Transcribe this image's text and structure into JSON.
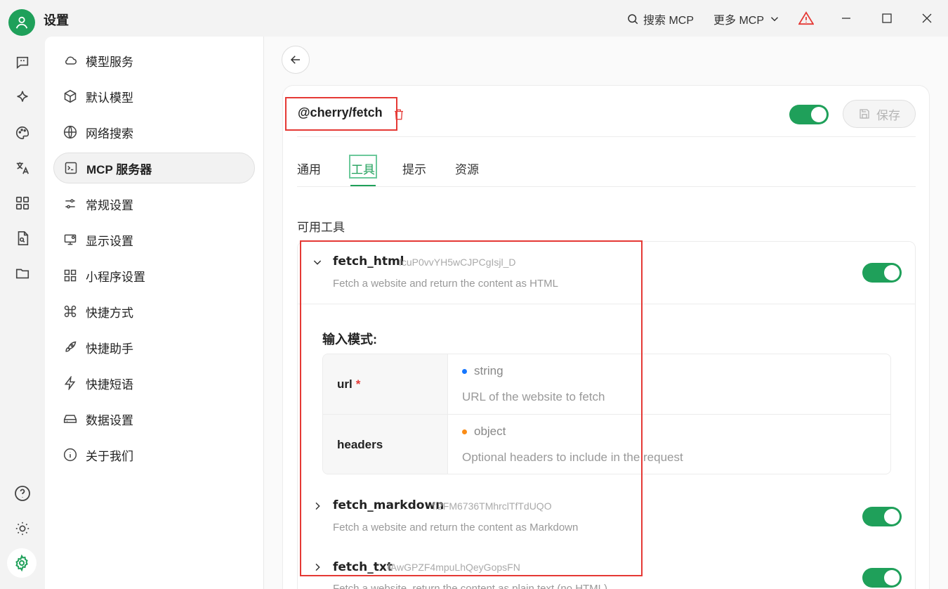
{
  "app": {
    "title": "设置"
  },
  "titlebar": {
    "search_label": "搜索 MCP",
    "more_label": "更多 MCP"
  },
  "colors": {
    "accent": "#1fa05a",
    "highlight_box": "#e53935",
    "warning": "#e53935"
  },
  "rail": {
    "icons": [
      "chat-icon",
      "sparkle-icon",
      "palette-icon",
      "translate-icon",
      "apps-grid-icon",
      "file-search-icon",
      "folder-icon",
      "help-icon",
      "sun-icon",
      "settings-gear-icon"
    ]
  },
  "menu": {
    "items": [
      {
        "label": "模型服务",
        "icon": "cloud-icon"
      },
      {
        "label": "默认模型",
        "icon": "cube-icon"
      },
      {
        "label": "网络搜索",
        "icon": "globe-icon"
      },
      {
        "label": "MCP 服务器",
        "icon": "terminal-icon",
        "active": true
      },
      {
        "label": "常规设置",
        "icon": "sliders-icon"
      },
      {
        "label": "显示设置",
        "icon": "monitor-settings-icon"
      },
      {
        "label": "小程序设置",
        "icon": "grid-icon"
      },
      {
        "label": "快捷方式",
        "icon": "command-icon"
      },
      {
        "label": "快捷助手",
        "icon": "rocket-icon"
      },
      {
        "label": "快捷短语",
        "icon": "zap-icon"
      },
      {
        "label": "数据设置",
        "icon": "hard-drive-icon"
      },
      {
        "label": "关于我们",
        "icon": "info-icon"
      }
    ]
  },
  "server": {
    "name": "@cherry/fetch",
    "enabled": true,
    "save_label": "保存"
  },
  "tabs": [
    {
      "label": "通用"
    },
    {
      "label": "工具",
      "active": true
    },
    {
      "label": "提示"
    },
    {
      "label": "资源"
    }
  ],
  "tools_section": {
    "title": "可用工具",
    "schema_title": "输入模式:",
    "tools": [
      {
        "name": "fetch_html",
        "id": "fcuP0vvYH5wCJPCgIsjl_D",
        "description": "Fetch a website and return the content as HTML",
        "enabled": true,
        "expanded": true,
        "params": [
          {
            "key": "url",
            "required": true,
            "type": "string",
            "type_color": "#1677ff",
            "description": "URL of the website to fetch"
          },
          {
            "key": "headers",
            "required": false,
            "type": "object",
            "type_color": "#fa8c16",
            "description": "Optional headers to include in the request"
          }
        ]
      },
      {
        "name": "fetch_markdown",
        "id": "fi2FM6736TMhrclTfTdUQO",
        "description": "Fetch a website and return the content as Markdown",
        "enabled": true,
        "expanded": false
      },
      {
        "name": "fetch_txt",
        "id": "fAwGPZF4mpuLhQeyGopsFN",
        "description": "Fetch a website, return the content as plain text (no HTML)",
        "enabled": true,
        "expanded": false
      }
    ]
  }
}
